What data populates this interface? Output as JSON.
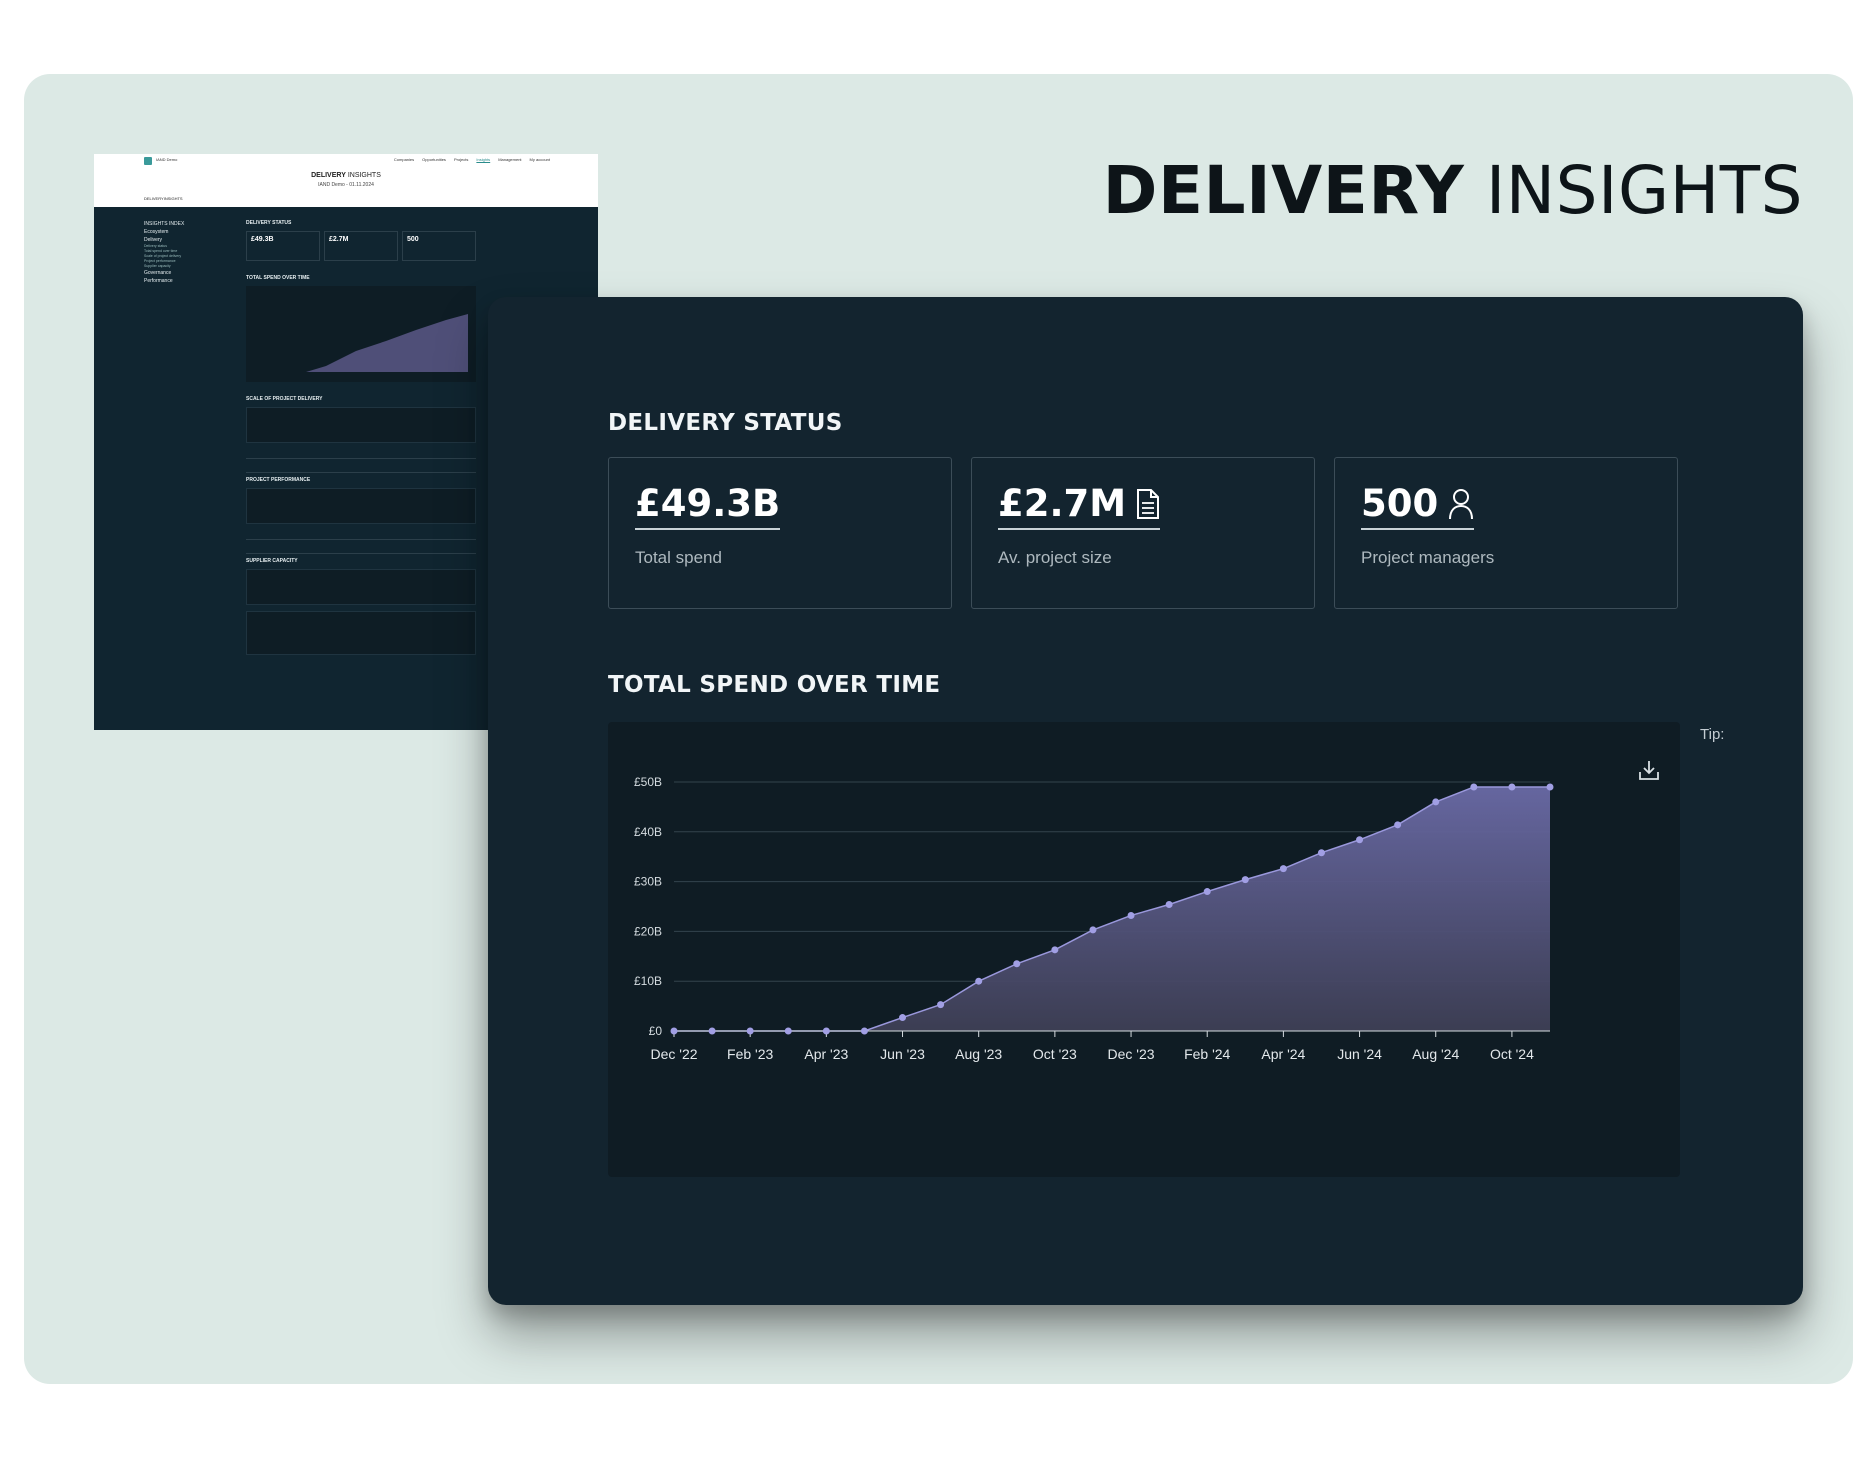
{
  "hero": {
    "title_strong": "DELIVERY",
    "title_light": "INSIGHTS"
  },
  "preview": {
    "brand": "IAND Demo",
    "nav": [
      "Companies",
      "Opportunities",
      "Projects",
      "Insights",
      "Management",
      "My account"
    ],
    "title_strong": "DELIVERY",
    "title_light": "INSIGHTS",
    "subtitle": "IAND Demo - 01.11.2024",
    "crumb": "DELIVERYINSIGHTS",
    "sidebar_heading": "INSIGHTS INDEX",
    "sidebar_items": [
      "Ecosystem",
      "Delivery",
      "Governance",
      "Performance"
    ],
    "sidebar_subitems": [
      "Delivery status",
      "Total spend over time",
      "Scale of project delivery",
      "Project performance",
      "Supplier capacity"
    ],
    "sections": [
      "DELIVERY STATUS",
      "TOTAL SPEND OVER TIME",
      "SCALE OF PROJECT DELIVERY",
      "PROJECT PERFORMANCE",
      "SUPPLIER CAPACITY"
    ],
    "card_values": [
      "£49.3B",
      "£2.7M",
      "500"
    ]
  },
  "delivery_status": {
    "heading": "DELIVERY STATUS",
    "cards": [
      {
        "value": "£49.3B",
        "label": "Total spend",
        "icon": "none"
      },
      {
        "value": "£2.7M",
        "label": "Av. project size",
        "icon": "document-icon"
      },
      {
        "value": "500",
        "label": "Project managers",
        "icon": "person-icon"
      }
    ]
  },
  "spend_chart": {
    "heading": "TOTAL SPEND OVER TIME",
    "tip_text": "Tip: data",
    "download_icon": "download-icon"
  },
  "chart_data": {
    "type": "area",
    "title": "TOTAL SPEND OVER TIME",
    "xlabel": "",
    "ylabel": "",
    "x": [
      "Dec '22",
      "Jan '23",
      "Feb '23",
      "Mar '23",
      "Apr '23",
      "May '23",
      "Jun '23",
      "Jul '23",
      "Aug '23",
      "Sep '23",
      "Oct '23",
      "Nov '23",
      "Dec '23",
      "Jan '24",
      "Feb '24",
      "Mar '24",
      "Apr '24",
      "May '24",
      "Jun '24",
      "Jul '24",
      "Aug '24",
      "Sep '24",
      "Oct '24",
      "Nov '24"
    ],
    "x_ticks": [
      "Dec '22",
      "Feb '23",
      "Apr '23",
      "Jun '23",
      "Aug '23",
      "Oct '23",
      "Dec '23",
      "Feb '24",
      "Apr '24",
      "Jun '24",
      "Aug '24",
      "Oct '24"
    ],
    "series": [
      {
        "values": [
          0,
          0,
          0,
          0,
          0,
          0,
          2.7,
          5.3,
          10.0,
          13.5,
          16.3,
          20.3,
          23.2,
          25.4,
          28.0,
          30.4,
          32.6,
          35.8,
          38.4,
          41.4,
          46.0,
          49.0,
          49.0,
          49.0
        ]
      }
    ],
    "ylim": [
      0,
      50
    ],
    "y_ticks": [
      "£0",
      "£10B",
      "£20B",
      "£30B",
      "£40B",
      "£50B"
    ],
    "grid": true,
    "colors": {
      "fill_top": "#6a6aa6",
      "fill_bottom": "#3e3f55",
      "line": "#9a98dc",
      "point": "#a19fe4"
    }
  }
}
